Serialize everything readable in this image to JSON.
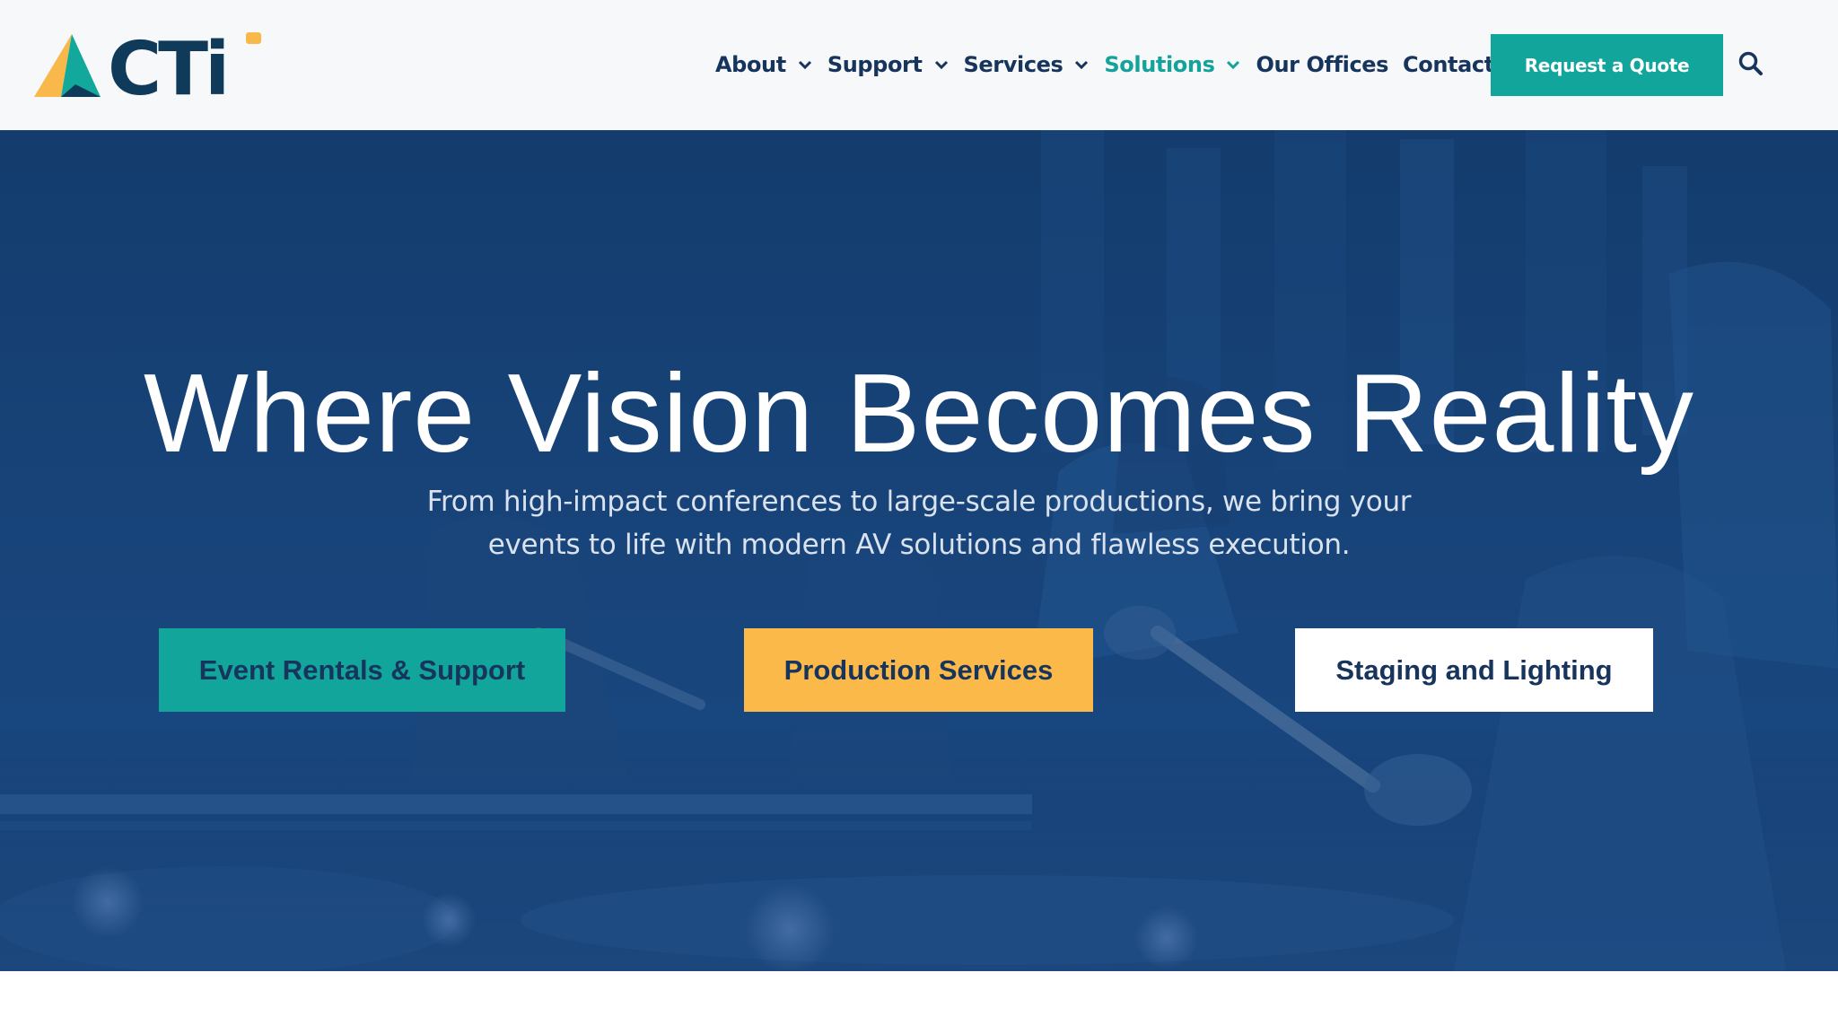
{
  "header": {
    "logo_text": "CTi",
    "nav": [
      {
        "label": "About",
        "has_dropdown": true,
        "active": false
      },
      {
        "label": "Support",
        "has_dropdown": true,
        "active": false
      },
      {
        "label": "Services",
        "has_dropdown": true,
        "active": false
      },
      {
        "label": "Solutions",
        "has_dropdown": true,
        "active": true
      },
      {
        "label": "Our Offices",
        "has_dropdown": false,
        "active": false
      },
      {
        "label": "Contact",
        "has_dropdown": false,
        "active": false
      }
    ],
    "cta_label": "Request a Quote",
    "search_icon": "search-icon"
  },
  "hero": {
    "title": "Where Vision Becomes Reality",
    "subtitle": "From high-impact conferences to large-scale productions, we bring your events to life with modern AV solutions and flawless execution.",
    "buttons": [
      {
        "label": "Event Rentals & Support",
        "color": "#11a59b"
      },
      {
        "label": "Production Services",
        "color": "#fbb94a"
      },
      {
        "label": "Staging and Lighting",
        "color": "#ffffff"
      }
    ]
  },
  "colors": {
    "brand_navy": "#17345c",
    "brand_teal": "#11a59b",
    "brand_yellow": "#fbb94a",
    "header_bg": "#f6f8f9"
  }
}
